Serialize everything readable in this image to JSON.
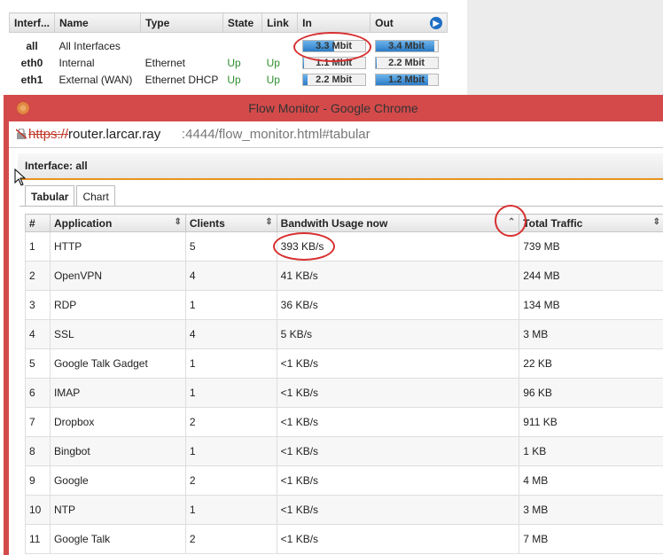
{
  "interfaces": {
    "columns": [
      "Interf...",
      "Name",
      "Type",
      "State",
      "Link",
      "In",
      "Out"
    ],
    "rows": [
      {
        "iface": "all",
        "name": "All Interfaces",
        "type": "",
        "state": "",
        "link": "",
        "in": "3.3 Mbit",
        "in_level": 0.5,
        "out": "3.4 Mbit",
        "out_level": 0.95
      },
      {
        "iface": "eth0",
        "name": "Internal",
        "type": "Ethernet",
        "state": "Up",
        "link": "Up",
        "in": "1.1 Mbit",
        "in_level": 0.0,
        "out": "2.2 Mbit",
        "out_level": 0.02
      },
      {
        "iface": "eth1",
        "name": "External (WAN)",
        "type": "Ethernet DHCP",
        "state": "Up",
        "link": "Up",
        "in": "2.2 Mbit",
        "in_level": 0.08,
        "out": "1.2 Mbit",
        "out_level": 0.85
      }
    ],
    "info_icon": "info-circle-icon"
  },
  "window": {
    "title": "Flow Monitor - Google Chrome",
    "url_scheme": "https://",
    "url_host": "router.larcar.ray",
    "url_rest": ":4444/flow_monitor.html#tabular"
  },
  "interface_label": "Interface: all",
  "tabs": [
    "Tabular",
    "Chart"
  ],
  "flow": {
    "columns": [
      "#",
      "Application",
      "Clients",
      "Bandwith Usage now",
      "Total Traffic"
    ],
    "rows": [
      {
        "n": "1",
        "app": "HTTP",
        "clients": "5",
        "bw": "393 KB/s",
        "total": "739 MB"
      },
      {
        "n": "2",
        "app": "OpenVPN",
        "clients": "4",
        "bw": "41 KB/s",
        "total": "244 MB"
      },
      {
        "n": "3",
        "app": "RDP",
        "clients": "1",
        "bw": "36 KB/s",
        "total": "134 MB"
      },
      {
        "n": "4",
        "app": "SSL",
        "clients": "4",
        "bw": "5 KB/s",
        "total": "3 MB"
      },
      {
        "n": "5",
        "app": "Google Talk Gadget",
        "clients": "1",
        "bw": "<1 KB/s",
        "total": "22 KB"
      },
      {
        "n": "6",
        "app": "IMAP",
        "clients": "1",
        "bw": "<1 KB/s",
        "total": "96 KB"
      },
      {
        "n": "7",
        "app": "Dropbox",
        "clients": "2",
        "bw": "<1 KB/s",
        "total": "911 KB"
      },
      {
        "n": "8",
        "app": "Bingbot",
        "clients": "1",
        "bw": "<1 KB/s",
        "total": "1 KB"
      },
      {
        "n": "9",
        "app": "Google",
        "clients": "2",
        "bw": "<1 KB/s",
        "total": "4 MB"
      },
      {
        "n": "10",
        "app": "NTP",
        "clients": "1",
        "bw": "<1 KB/s",
        "total": "3 MB"
      },
      {
        "n": "11",
        "app": "Google Talk",
        "clients": "2",
        "bw": "<1 KB/s",
        "total": "7 MB"
      }
    ]
  },
  "colors": {
    "window_frame": "#d44a4a",
    "accent": "#e8931f",
    "annotation": "#d83030",
    "bar_fill": "#2c7cc6"
  }
}
